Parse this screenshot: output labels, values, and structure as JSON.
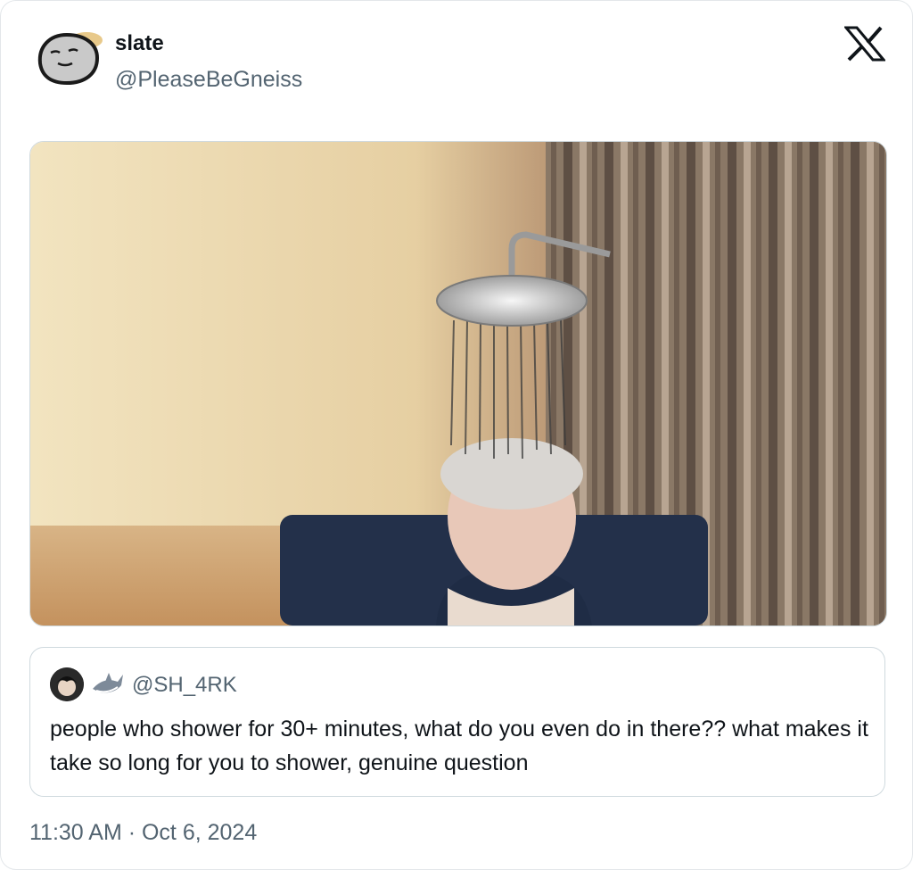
{
  "tweet": {
    "display_name": "slate",
    "handle": "@PleaseBeGneiss",
    "timestamp": "11:30 AM · Oct 6, 2024"
  },
  "icons": {
    "platform": "x-logo-icon",
    "quote_badge": "shark-icon"
  },
  "quoted_tweet": {
    "handle": "@SH_4RK",
    "text": "people who shower for 30+ minutes, what do you even do in there?? what makes it take so long for you to shower, genuine question"
  },
  "colors": {
    "text_primary": "#0f1419",
    "text_secondary": "#536471",
    "border": "#cfd9de"
  }
}
